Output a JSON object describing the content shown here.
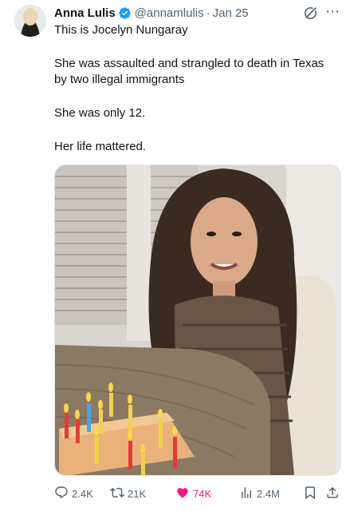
{
  "author": {
    "name": "Anna Lulis",
    "handle": "@annamlulis",
    "separator": "·",
    "date": "Jan 25",
    "verified": true
  },
  "tweet": {
    "line1": "This is Jocelyn Nungaray",
    "line2": "She was assaulted and strangled to death in Texas by two illegal immigrants",
    "line3": "She was only 12.",
    "line4": "Her life mattered."
  },
  "stats": {
    "replies": "2.4K",
    "retweets": "21K",
    "likes": "74K",
    "views": "2.4M"
  },
  "icons": {
    "verified": "verified-badge-icon",
    "grok": "grok-icon",
    "more": "more-icon",
    "reply": "reply-icon",
    "retweet": "retweet-icon",
    "like": "heart-icon",
    "views": "views-icon",
    "bookmark": "bookmark-icon",
    "share": "share-icon"
  },
  "colors": {
    "verified": "#1d9bf0",
    "like": "#f91880",
    "secondary_text": "#536471"
  }
}
